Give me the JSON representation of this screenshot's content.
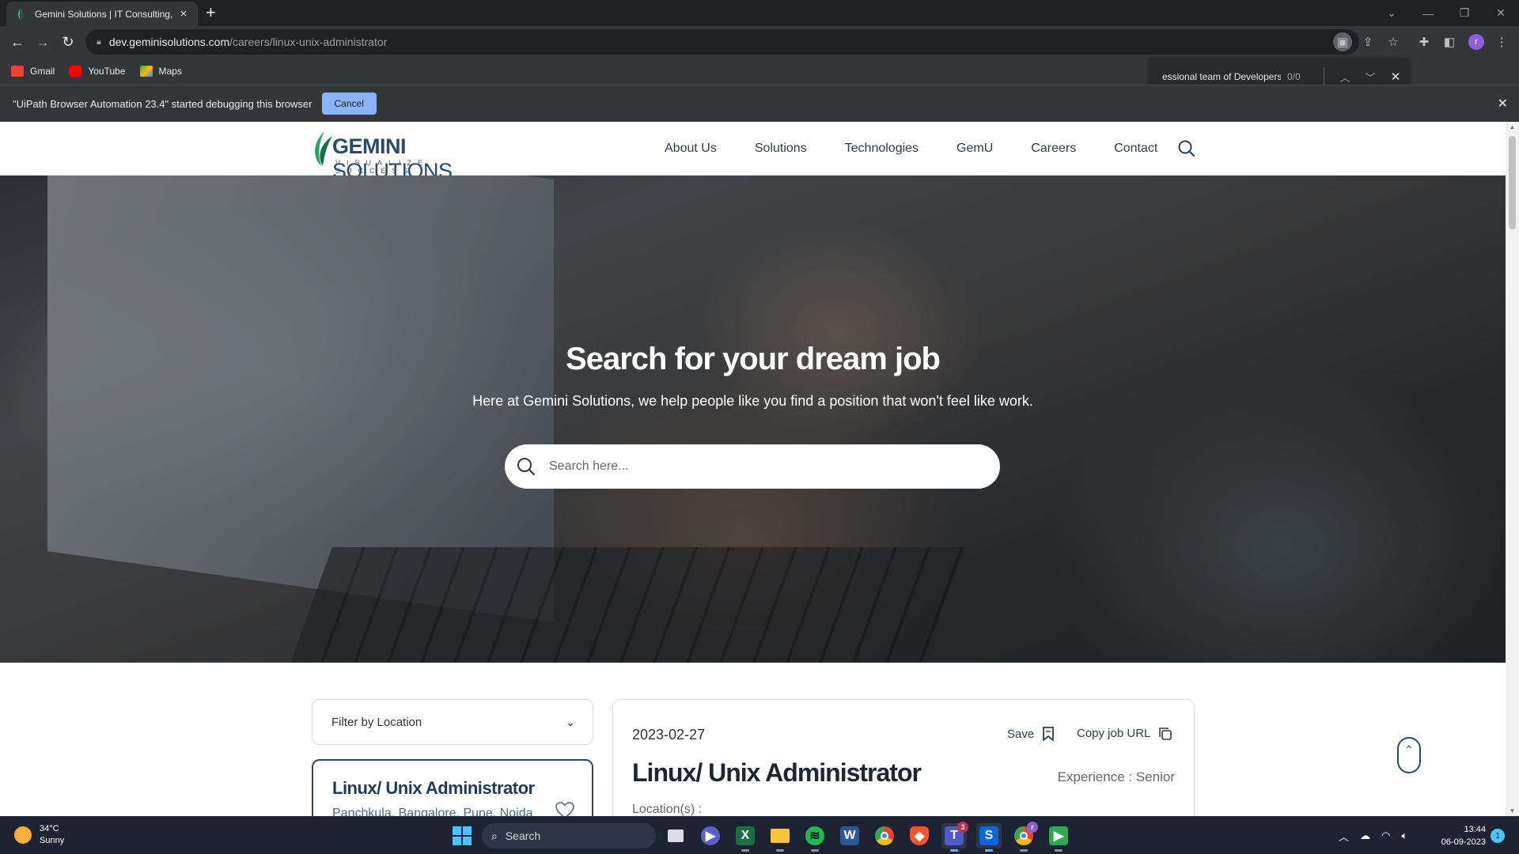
{
  "browser": {
    "tab": {
      "title": "Gemini Solutions | IT Consulting,"
    },
    "address": {
      "host": "dev.geminisolutions.com",
      "path": "/careers/linux-unix-administrator"
    },
    "bookmarks": [
      {
        "label": "Gmail",
        "icon": "gmail-icon",
        "color": "#ea4335"
      },
      {
        "label": "YouTube",
        "icon": "youtube-icon",
        "color": "#ff0000"
      },
      {
        "label": "Maps",
        "icon": "maps-icon",
        "color": "#34a853"
      }
    ],
    "find": {
      "query": "essional team of Developers",
      "count": "0/0"
    },
    "infobar": {
      "message": "\"UiPath Browser Automation 23.4\" started debugging this browser",
      "cancel_label": "Cancel"
    },
    "profile_initial": "r"
  },
  "site": {
    "logo": {
      "brand_light": "GEMINI",
      "brand_rest": " SOLUTIONS",
      "tagline": "VISUALIZE SUCCESS"
    },
    "nav": [
      "About Us",
      "Solutions",
      "Technologies",
      "GemU",
      "Careers",
      "Contact"
    ],
    "hero": {
      "title": "Search for your dream job",
      "subtitle": "Here at Gemini Solutions, we help people like you find a position that won't feel like work.",
      "search_placeholder": "Search here..."
    },
    "filter": {
      "label": "Filter by Location"
    },
    "job_card": {
      "title": "Linux/ Unix Administrator",
      "locations": "Panchkula, Bangalore, Pune, Noida"
    },
    "detail": {
      "date": "2023-02-27",
      "save_label": "Save",
      "copy_label": "Copy job URL",
      "title": "Linux/ Unix Administrator",
      "experience": "Experience : Senior",
      "locations_label": "Location(s) :"
    }
  },
  "taskbar": {
    "weather": {
      "temp": "34°C",
      "condition": "Sunny"
    },
    "search_label": "Search",
    "apps": [
      {
        "name": "task-view",
        "icon": "task-view-icon"
      },
      {
        "name": "meet",
        "icon": "meet-icon"
      },
      {
        "name": "excel",
        "icon": "excel-icon",
        "letter": "X",
        "color": "#1d6f42"
      },
      {
        "name": "file-explorer",
        "icon": "folder-icon"
      },
      {
        "name": "spotify",
        "icon": "spotify-icon",
        "color": "#1db954"
      },
      {
        "name": "word",
        "icon": "word-icon",
        "letter": "W",
        "color": "#2b579a"
      },
      {
        "name": "chrome",
        "icon": "chrome-icon"
      },
      {
        "name": "brave",
        "icon": "brave-icon",
        "color": "#fb542b"
      },
      {
        "name": "teams",
        "icon": "teams-icon",
        "letter": "T",
        "color": "#5059c9",
        "badge": "3"
      },
      {
        "name": "uipath-studio",
        "icon": "uipath-icon",
        "letter": "S",
        "color": "#0067df"
      },
      {
        "name": "chrome-profile",
        "icon": "chrome-profile-icon",
        "badge": "r"
      },
      {
        "name": "uipath-assistant",
        "icon": "uipath-assistant-icon",
        "color": "#2fa84f"
      }
    ],
    "clock": {
      "time": "13:44",
      "date": "06-09-2023"
    },
    "notifications": "1"
  }
}
